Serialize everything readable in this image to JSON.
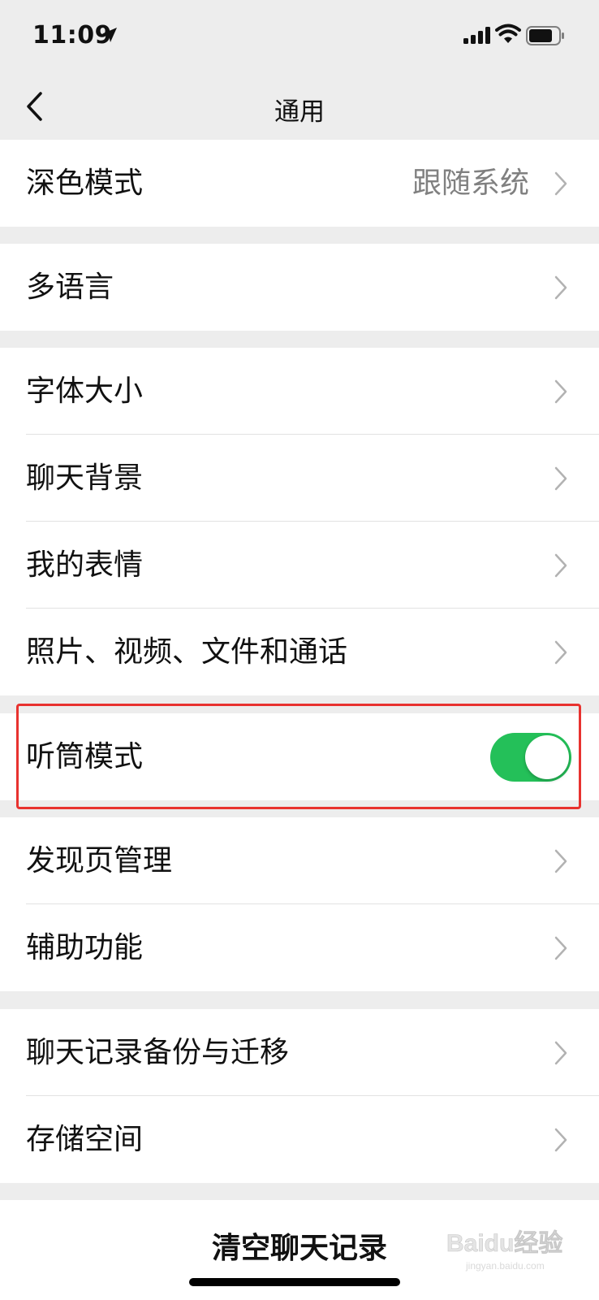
{
  "status_bar": {
    "time": "11:09"
  },
  "nav": {
    "title": "通用"
  },
  "groups": [
    {
      "items": [
        {
          "label": "深色模式",
          "value": "跟随系统"
        }
      ]
    },
    {
      "items": [
        {
          "label": "多语言"
        }
      ]
    },
    {
      "items": [
        {
          "label": "字体大小"
        },
        {
          "label": "聊天背景"
        },
        {
          "label": "我的表情"
        },
        {
          "label": "照片、视频、文件和通话"
        }
      ]
    },
    {
      "items": [
        {
          "label": "听筒模式",
          "toggle": true
        }
      ]
    },
    {
      "items": [
        {
          "label": "发现页管理"
        },
        {
          "label": "辅助功能"
        }
      ]
    },
    {
      "items": [
        {
          "label": "聊天记录备份与迁移"
        },
        {
          "label": "存储空间"
        }
      ]
    }
  ],
  "clear_chat": {
    "label": "清空聊天记录"
  },
  "watermark": {
    "text": "Baidu经验",
    "subtext": "jingyan.baidu.com"
  },
  "colors": {
    "toggle_on": "#24c059",
    "highlight": "#e8322f",
    "background": "#ededed"
  }
}
